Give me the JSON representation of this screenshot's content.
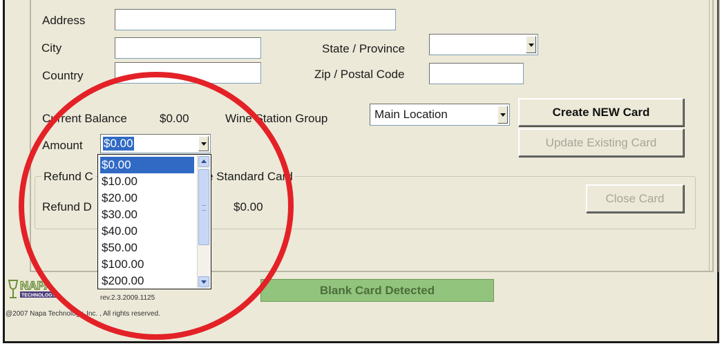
{
  "form": {
    "address_label": "Address",
    "address_value": "",
    "city_label": "City",
    "city_value": "",
    "country_label": "Country",
    "country_value": "",
    "state_label": "State / Province",
    "state_value": "",
    "zip_label": "Zip / Postal Code",
    "zip_value": "",
    "current_balance_label": "Current Balance",
    "current_balance_value": "$0.00",
    "wine_station_group_label": "Wine Station Group",
    "wine_station_group_value": "Main Location",
    "amount_label": "Amount",
    "amount_value": "$0.00"
  },
  "buttons": {
    "create_new_card": "Create NEW Card",
    "update_existing_card": "Update Existing Card",
    "close_card": "Close Card"
  },
  "refund_group": {
    "title_start": "Refund C",
    "title_end": "e Standard Card",
    "refund_label": "Refund D",
    "refund_value": "$0.00"
  },
  "amount_dropdown": {
    "options": [
      "$0.00",
      "$10.00",
      "$20.00",
      "$30.00",
      "$40.00",
      "$50.00",
      "$100.00",
      "$200.00"
    ],
    "selected_index": 0
  },
  "status": {
    "text": "Blank Card Detected",
    "color": "#93c47d"
  },
  "footer": {
    "logo_text": "NAPA",
    "logo_sub": "TECHNOLOGY",
    "version": "rev.2.3.2009.1125",
    "copyright": "@2007 Napa Technology, Inc. , All rights reserved."
  },
  "annotation": {
    "circle_color": "#e32127"
  }
}
